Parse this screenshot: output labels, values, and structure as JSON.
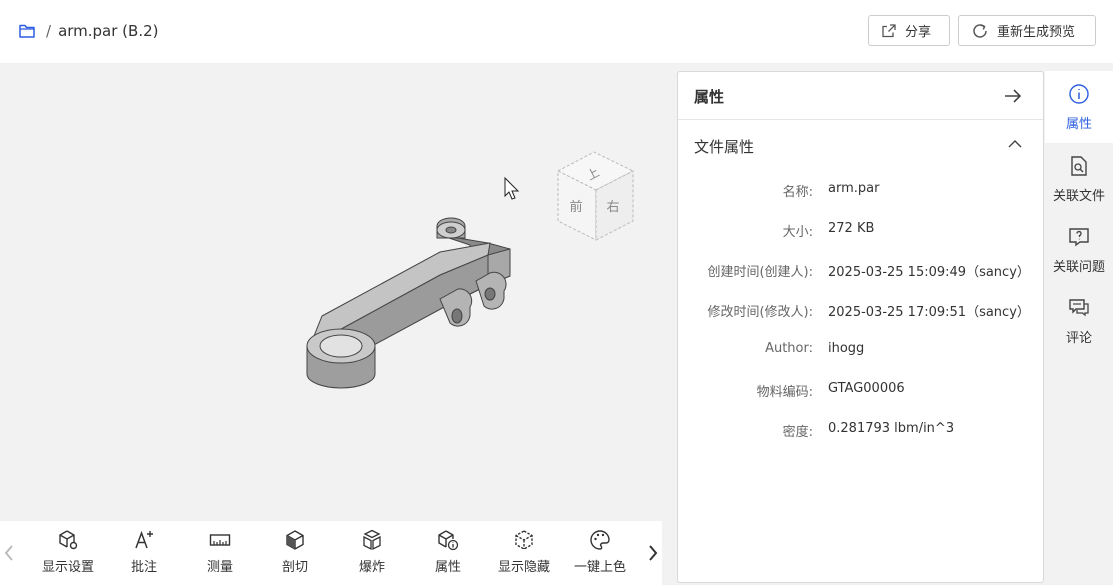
{
  "breadcrumb": {
    "separator": "/",
    "file": "arm.par (B.2)"
  },
  "header": {
    "share_label": "分享",
    "regen_label": "重新生成预览"
  },
  "viewcube": {
    "top": "上",
    "front": "前",
    "right": "右"
  },
  "toolbar": {
    "tools": [
      {
        "label": "显示设置",
        "icon": "display-settings-icon"
      },
      {
        "label": "批注",
        "icon": "annotate-icon"
      },
      {
        "label": "测量",
        "icon": "measure-icon"
      },
      {
        "label": "剖切",
        "icon": "section-icon"
      },
      {
        "label": "爆炸",
        "icon": "explode-icon"
      },
      {
        "label": "属性",
        "icon": "properties-icon"
      },
      {
        "label": "显示隐藏",
        "icon": "show-hide-icon"
      },
      {
        "label": "一键上色",
        "icon": "color-palette-icon"
      }
    ]
  },
  "panel": {
    "title": "属性",
    "section_title": "文件属性",
    "properties": [
      {
        "key": "名称:",
        "value": "arm.par"
      },
      {
        "key": "大小:",
        "value": "272 KB"
      },
      {
        "key": "创建时间(创建人):",
        "value": "2025-03-25 15:09:49（sancy）"
      },
      {
        "key": "修改时间(修改人):",
        "value": "2025-03-25 17:09:51（sancy）"
      },
      {
        "key": "Author:",
        "value": "ihogg"
      },
      {
        "key": "物料编码:",
        "value": "GTAG00006"
      },
      {
        "key": "密度:",
        "value": "0.281793 lbm/in^3"
      }
    ]
  },
  "sidebar": {
    "items": [
      {
        "label": "属性",
        "icon": "info-icon",
        "active": true
      },
      {
        "label": "关联文件",
        "icon": "linked-file-icon"
      },
      {
        "label": "关联问题",
        "icon": "linked-issue-icon"
      },
      {
        "label": "评论",
        "icon": "comment-icon"
      }
    ]
  },
  "colors": {
    "accent": "#2f5fe0",
    "border": "#d9d9d9",
    "background": "#f2f2f2"
  }
}
